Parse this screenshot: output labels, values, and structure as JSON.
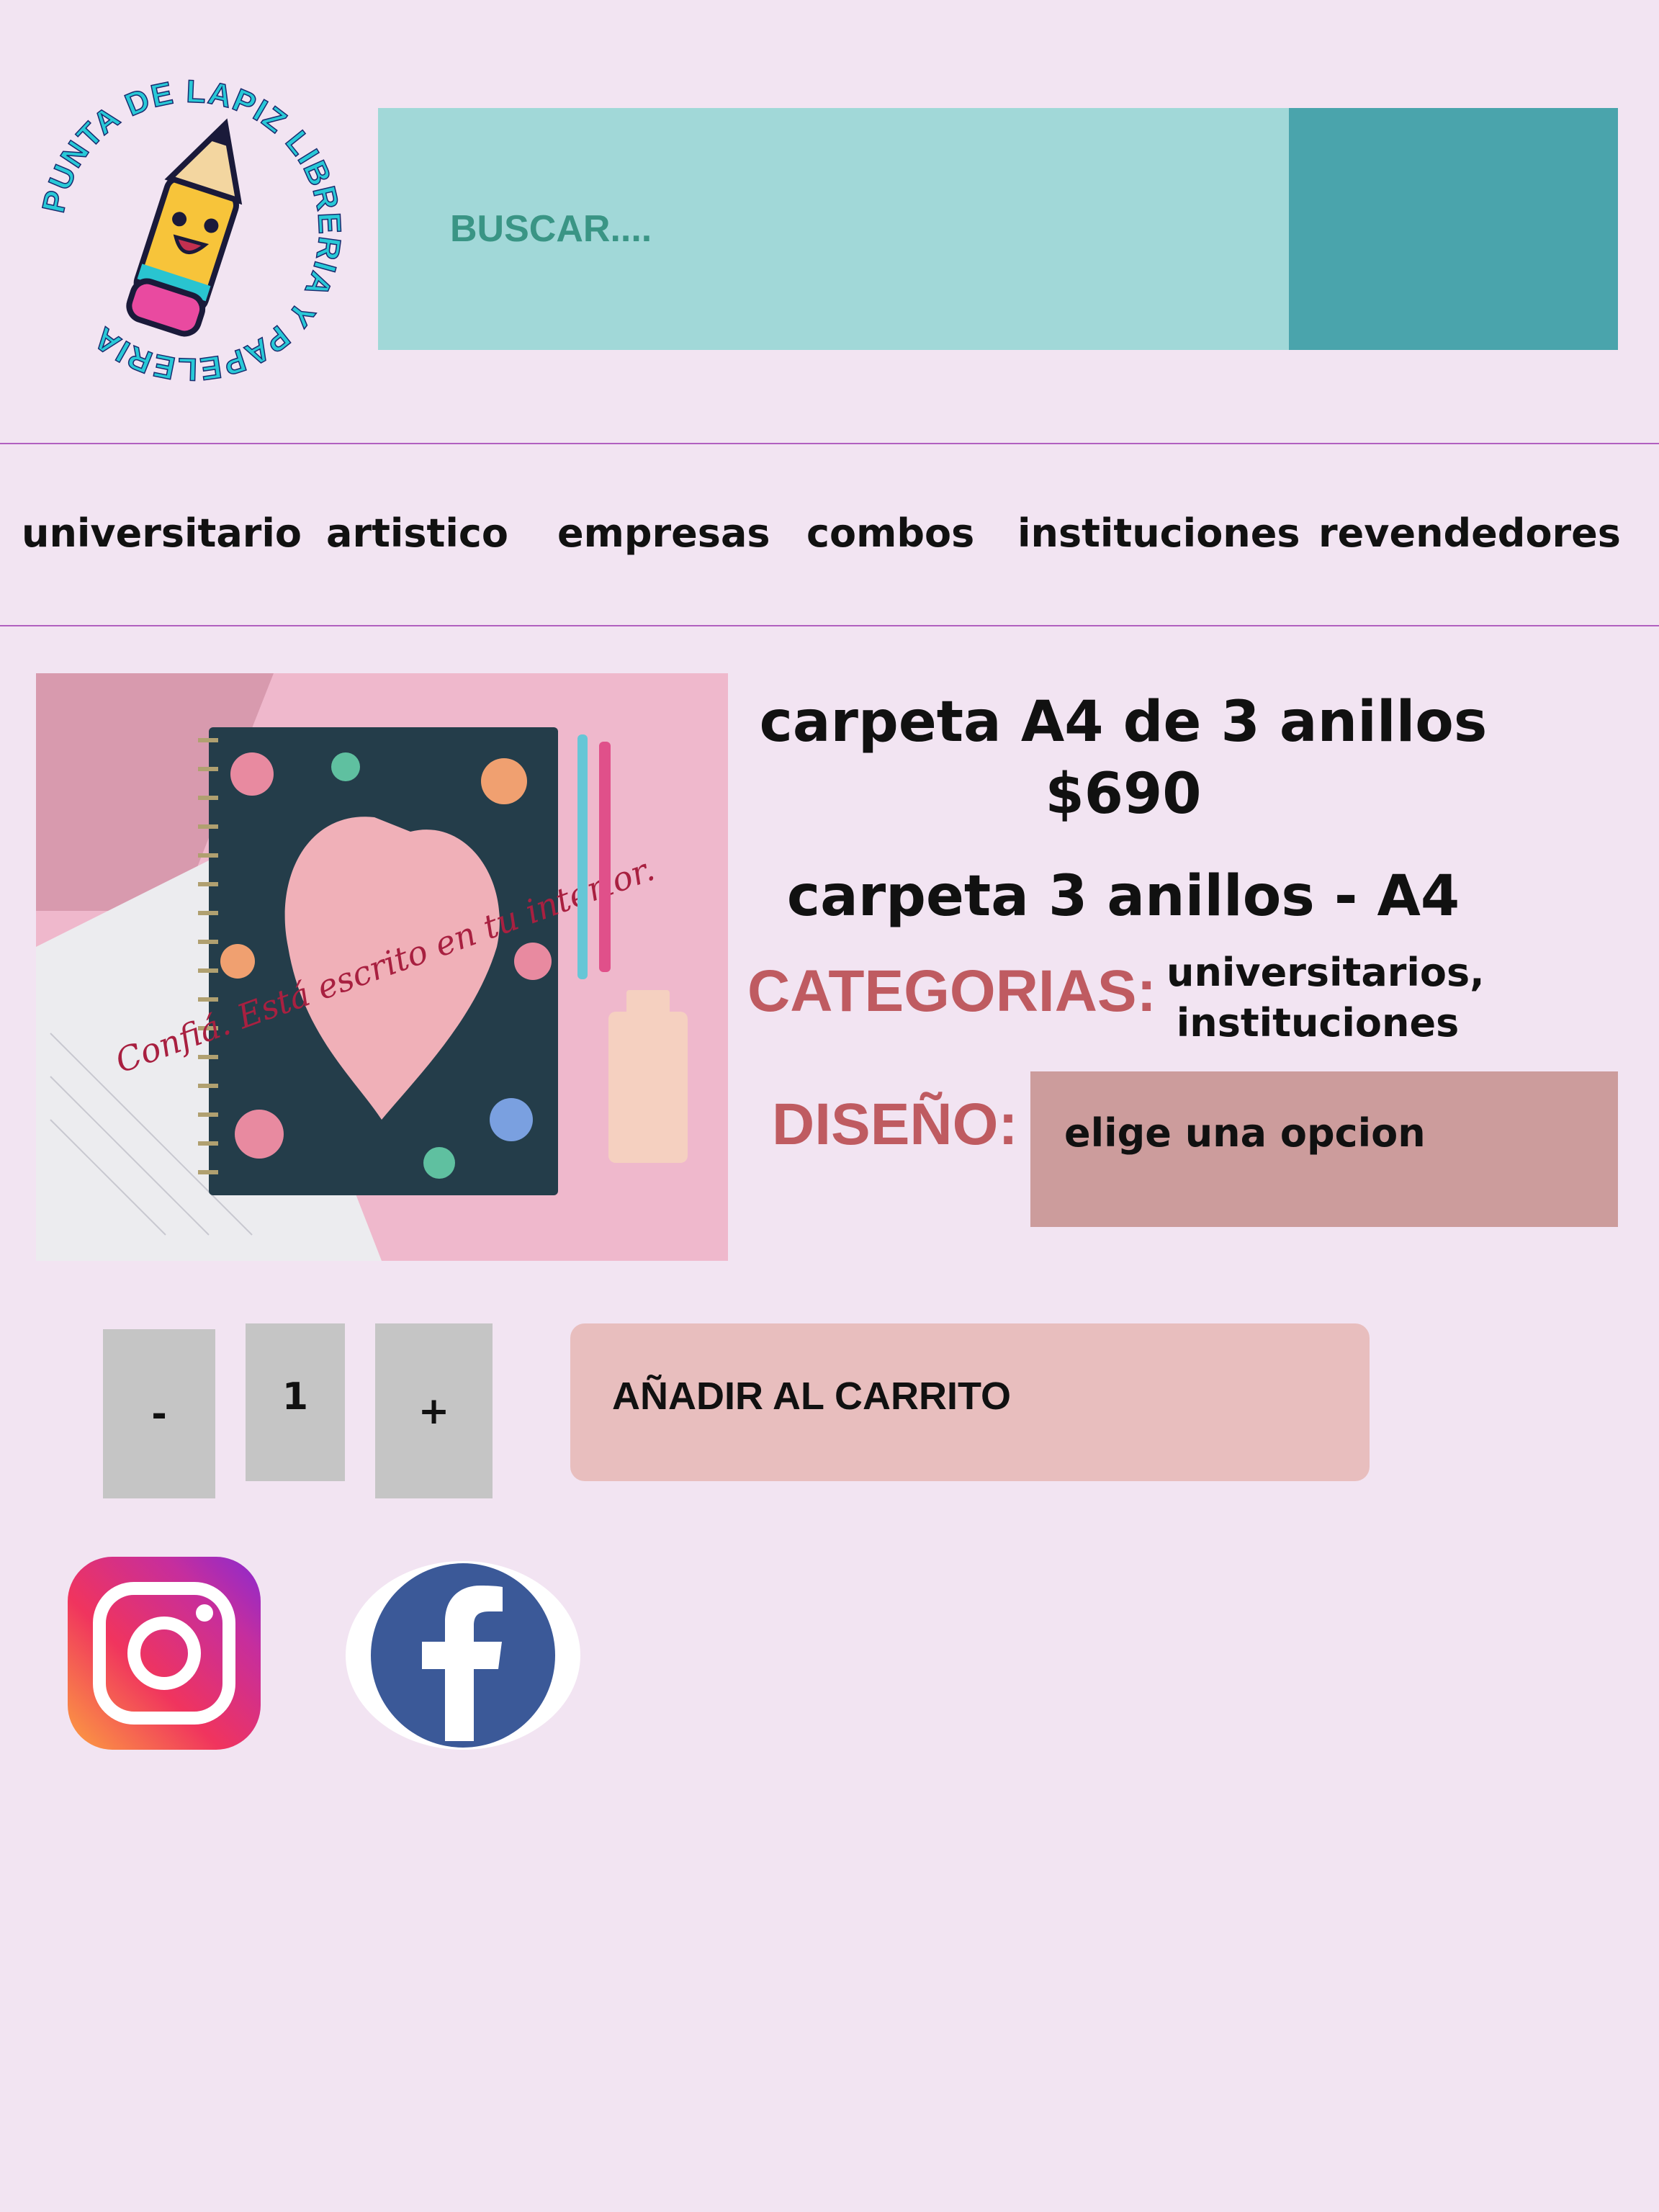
{
  "brand": {
    "logo_text": "PUNTA DE LAPIZ LIBRERIA Y PAPELERIA",
    "logo_icon": "pencil-mascot-icon"
  },
  "search": {
    "placeholder": "BUSCAR...."
  },
  "nav": {
    "items": [
      "universitario",
      "artistico",
      "empresas",
      "combos",
      "instituciones",
      "revendedores"
    ]
  },
  "product": {
    "image_text": "Confiá. Está escrito en tu interior.",
    "title": "carpeta A4 de 3 anillos",
    "price": "$690",
    "subtitle": "carpeta 3 anillos - A4",
    "categories_label": "CATEGORIAS:",
    "categories": [
      "universitarios,",
      "instituciones"
    ],
    "design_label": "DISEÑO:",
    "design_value": "elige una opcion"
  },
  "cart": {
    "minus_label": "-",
    "quantity": "1",
    "plus_label": "+",
    "add_label": "AÑADIR AL CARRITO"
  },
  "social": {
    "icons": [
      "instagram-icon",
      "facebook-icon"
    ]
  },
  "colors": {
    "background": "#f2e4f2",
    "search_field": "#a1d8d8",
    "search_button": "#4aa4ac",
    "accent_red": "#bf5b61",
    "select_bg": "#cc9c9c",
    "cart_button": "#e8bebe"
  }
}
